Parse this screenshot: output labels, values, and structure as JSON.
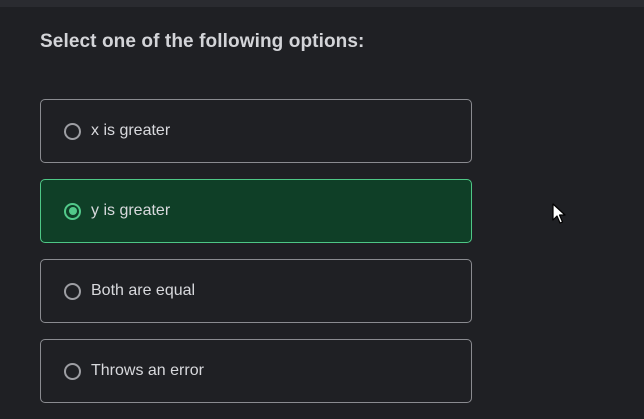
{
  "question": {
    "prompt": "Select one of the following options:"
  },
  "options": [
    {
      "label": "x is greater",
      "selected": false
    },
    {
      "label": "y is greater",
      "selected": true
    },
    {
      "label": "Both are equal",
      "selected": false
    },
    {
      "label": "Throws an error",
      "selected": false
    }
  ],
  "colors": {
    "background": "#1f2024",
    "selected_background": "#0f3f27",
    "selected_border": "#4ec786",
    "accent": "#52c98a"
  },
  "icons": {
    "radio": "radio-button-icon",
    "cursor": "mouse-pointer-icon"
  }
}
